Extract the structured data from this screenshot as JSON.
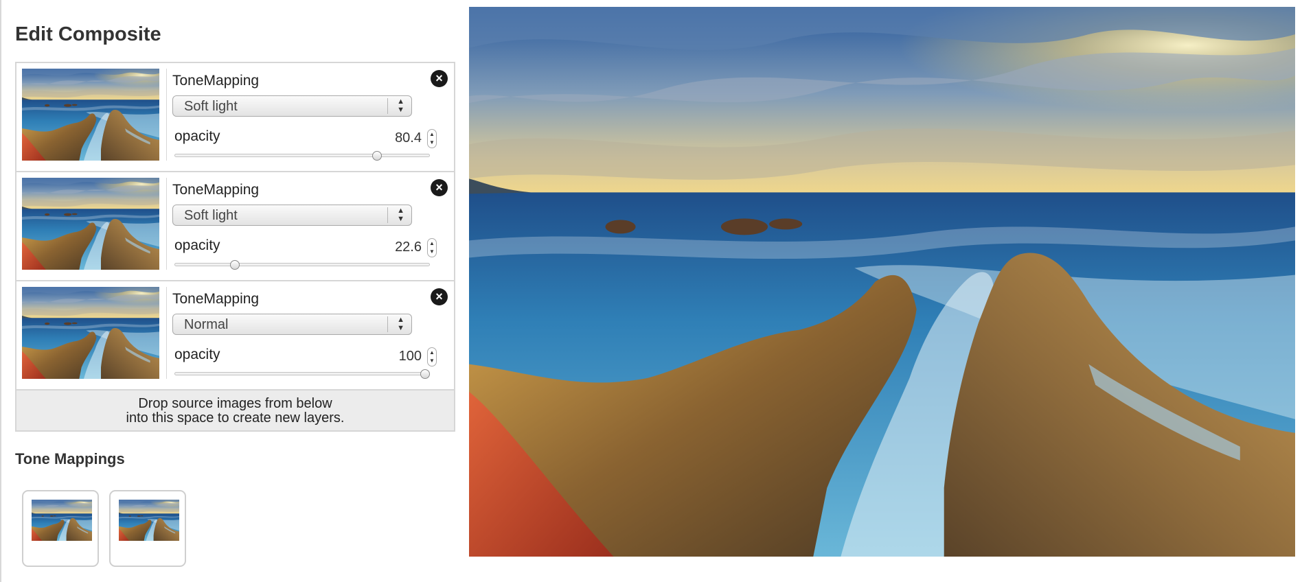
{
  "panel": {
    "title": "Edit Composite",
    "layers": [
      {
        "name": "ToneMapping",
        "blend_mode": "Soft light",
        "opacity_label": "opacity",
        "opacity": "80.4",
        "opacity_fraction": 0.804
      },
      {
        "name": "ToneMapping",
        "blend_mode": "Soft light",
        "opacity_label": "opacity",
        "opacity": "22.6",
        "opacity_fraction": 0.226
      },
      {
        "name": "ToneMapping",
        "blend_mode": "Normal",
        "opacity_label": "opacity",
        "opacity": "100",
        "opacity_fraction": 1.0
      }
    ],
    "drop_zone": {
      "line1": "Drop source images from below",
      "line2": "into this space to create new layers."
    },
    "tone_mappings_title": "Tone Mappings",
    "tone_mappings": [
      {
        "icon": "thumbnail-image-icon"
      },
      {
        "icon": "thumbnail-image-icon"
      }
    ]
  },
  "icons": {
    "close": "close-icon",
    "select_arrows": "select-arrows-icon",
    "stepper": "stepper-icon"
  },
  "colors": {
    "close_button": "#1a1a1a",
    "border": "#d6d6d6",
    "drop_zone_bg": "#ececec"
  }
}
